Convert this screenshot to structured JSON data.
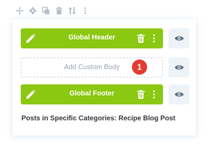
{
  "toolbar": {
    "icons": [
      "move-icon",
      "settings-icon",
      "duplicate-icon",
      "delete-icon",
      "sort-icon",
      "more-icon"
    ],
    "icon_color": "#b5bdc6"
  },
  "layouts": {
    "header": {
      "label": "Global Header"
    },
    "body": {
      "label": "Add Custom Body",
      "badge": "1"
    },
    "footer": {
      "label": "Global Footer"
    }
  },
  "assignment": "Posts in Specific Categories: Recipe Blog Post",
  "colors": {
    "global_layout": "#8bc811",
    "badge": "#e33b30",
    "eye_button_bg": "#eef3f8",
    "dashed_border": "#cdd6e0"
  }
}
